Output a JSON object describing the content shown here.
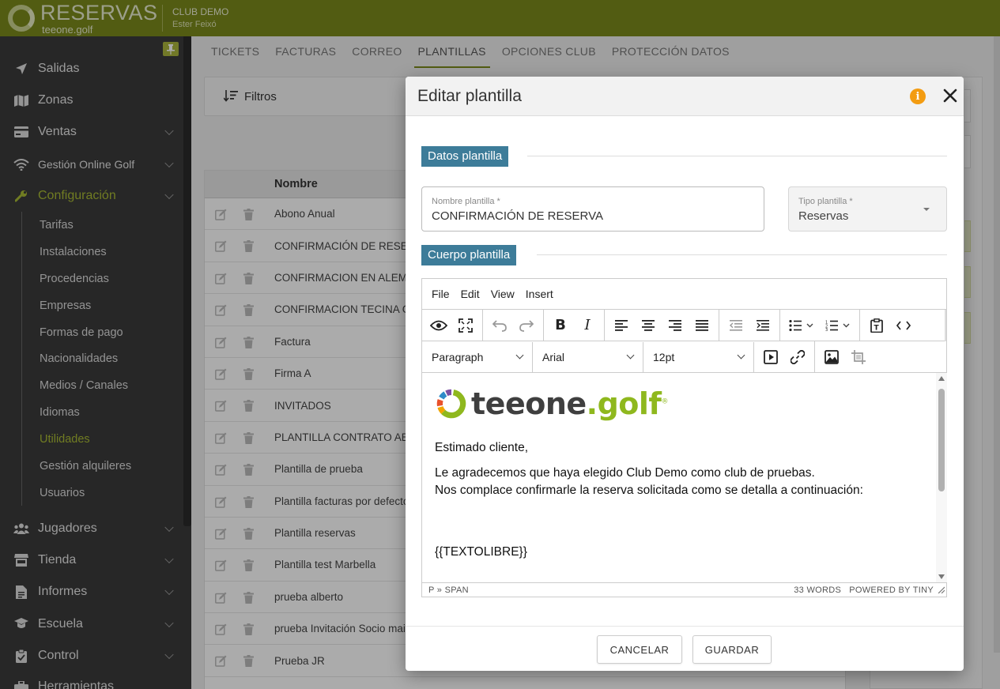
{
  "app": {
    "brand": "RESERVAS",
    "brand_sub": "teeone.golf",
    "club_name": "CLUB DEMO",
    "user_name": "Ester Feixó"
  },
  "sidebar": {
    "items": [
      {
        "label": "Salidas",
        "icon": "paper-plane-icon"
      },
      {
        "label": "Zonas",
        "icon": "map-icon"
      },
      {
        "label": "Ventas",
        "icon": "cash-icon"
      },
      {
        "label": "Gestión Online Golf",
        "icon": "wifi-icon"
      },
      {
        "label": "Configuración",
        "icon": "wrench-icon"
      },
      {
        "label": "Jugadores",
        "icon": "users-icon"
      },
      {
        "label": "Tienda",
        "icon": "store-icon"
      },
      {
        "label": "Informes",
        "icon": "report-icon"
      },
      {
        "label": "Escuela",
        "icon": "graduation-icon"
      },
      {
        "label": "Control",
        "icon": "clipboard-icon"
      },
      {
        "label": "Herramientas",
        "icon": "toolbox-icon"
      }
    ],
    "submenu": [
      "Tarifas",
      "Instalaciones",
      "Procedencias",
      "Empresas",
      "Formas de pago",
      "Nacionalidades",
      "Medios / Canales",
      "Idiomas",
      "Utilidades",
      "Gestión alquileres",
      "Usuarios"
    ]
  },
  "tabs": [
    "TICKETS",
    "FACTURAS",
    "CORREO",
    "PLANTILLAS",
    "OPCIONES CLUB",
    "PROTECCIÓN DATOS"
  ],
  "filters": {
    "label": "Filtros"
  },
  "table": {
    "header": "Nombre",
    "rows": [
      "Abono Anual",
      "CONFIRMACIÓN DE RESERVA",
      "CONFIRMACION EN ALEMÁN",
      "CONFIRMACION TECINA GOLF",
      "Factura",
      "Firma A",
      "INVITADOS",
      "PLANTILLA CONTRATO ABONOS",
      "Plantilla de prueba",
      "Plantilla facturas por defecto",
      "Plantilla reservas",
      "Plantilla test Marbella",
      "prueba alberto",
      "prueba Invitación Socio mail",
      "Prueba JR"
    ]
  },
  "modal": {
    "title": "Editar plantilla",
    "section1": "Datos plantilla",
    "name_label": "Nombre plantilla *",
    "name_value": "CONFIRMACIÓN DE RESERVA",
    "type_label": "Tipo plantilla *",
    "type_value": "Reservas",
    "section2": "Cuerpo plantilla",
    "cancel": "CANCELAR",
    "save": "GUARDAR"
  },
  "editor": {
    "menu": [
      "File",
      "Edit",
      "View",
      "Insert"
    ],
    "block_format": "Paragraph",
    "font_family": "Arial",
    "font_size": "12pt",
    "brand_left": "teeone",
    "brand_dot": ".",
    "brand_right": "golf",
    "brand_reg": "®",
    "greeting": "Estimado cliente,",
    "line1": "Le agradecemos que haya elegido Club Demo como club de pruebas.",
    "line2": "Nos complace confirmarle la reserva solicitada como se detalla a continuación:",
    "placeholder_var": "{{TEXTOLIBRE}}",
    "status_path": "P » SPAN",
    "status_words": "33 WORDS",
    "status_powered": "POWERED BY TINY"
  },
  "colors": {
    "topbar": "#7b8a1b",
    "accent": "#a8b934",
    "section_tag": "#3d7c99",
    "info": "#f39c12"
  }
}
